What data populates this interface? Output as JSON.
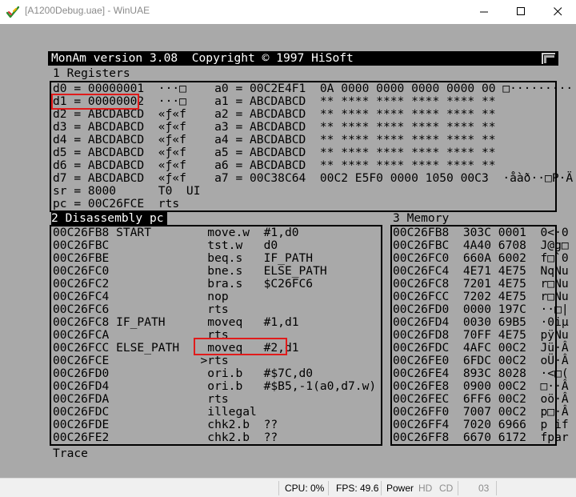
{
  "window": {
    "title": "[A1200Debug.uae] - WinUAE"
  },
  "monitor": {
    "header": "MonAm version 3.08  Copyright © 1997 HiSoft",
    "registers_title": "1 Registers",
    "registers": [
      "d0 = 00000001  ···□    a0 = 00C2E4F1  0A 0000 0000 0000 0000 00 □·········",
      "d1 = 00000002  ···□    a1 = ABCDABCD  ** **** **** **** **** **",
      "d2 = ABCDABCD  «ƒ«f    a2 = ABCDABCD  ** **** **** **** **** **",
      "d3 = ABCDABCD  «ƒ«f    a3 = ABCDABCD  ** **** **** **** **** **",
      "d4 = ABCDABCD  «ƒ«f    a4 = ABCDABCD  ** **** **** **** **** **",
      "d5 = ABCDABCD  «ƒ«f    a5 = ABCDABCD  ** **** **** **** **** **",
      "d6 = ABCDABCD  «ƒ«f    a6 = ABCDABCD  ** **** **** **** **** **",
      "d7 = ABCDABCD  «ƒ«f    a7 = 00C38C64  00C2 E5F0 0000 1050 00C3  ·åàð··□P·Ä",
      "sr = 8000      T0  UI",
      "pc = 00C26FCE  rts"
    ],
    "disassembly_title": "2 Disassembly pc",
    "disassembly": [
      "00C26FB8 START        move.w  #1,d0",
      "00C26FBC              tst.w   d0",
      "00C26FBE              beq.s   IF_PATH",
      "00C26FC0              bne.s   ELSE_PATH",
      "00C26FC2              bra.s   $C26FC6",
      "00C26FC4              nop",
      "00C26FC6              rts",
      "00C26FC8 IF_PATH      moveq   #1,d1",
      "00C26FCA              rts",
      "00C26FCC ELSE_PATH    moveq   #2,d1",
      "00C26FCE             >rts",
      "00C26FD0              ori.b   #$7C,d0",
      "00C26FD4              ori.b   #$B5,-1(a0,d7.w)",
      "00C26FDA              rts",
      "00C26FDC              illegal",
      "00C26FDE              chk2.b  ??",
      "00C26FE2              chk2.b  ??"
    ],
    "memory_title": "3 Memory",
    "memory": [
      "00C26FB8  303C 0001  0<·0",
      "00C26FBC  4A40 6708  J@g□",
      "00C26FC0  660A 6002  f□`0",
      "00C26FC4  4E71 4E75  NqNu",
      "00C26FC8  7201 4E75  r□Nu",
      "00C26FCC  7202 4E75  r□Nu",
      "00C26FD0  0000 197C  ··□|",
      "00C26FD4  0030 69B5  ·0iµ",
      "00C26FD8  70FF 4E75  pÿNu",
      "00C26FDC  4AFC 00C2  Jü·Â",
      "00C26FE0  6FDC 00C2  oÜ·Â",
      "00C26FE4  893C 8028  ·<□(",
      "00C26FE8  0900 00C2  □··Â",
      "00C26FEC  6FF6 00C2  oö·Â",
      "00C26FF0  7007 00C2  p□·Â",
      "00C26FF4  7020 6966  p if",
      "00C26FF8  6670 6172  fpar"
    ],
    "footer": "Trace"
  },
  "statusbar": {
    "cpu": "CPU: 0%",
    "fps": "FPS: 49.6",
    "power": "Power",
    "hd": "HD",
    "cd": "CD",
    "drive": "03"
  }
}
